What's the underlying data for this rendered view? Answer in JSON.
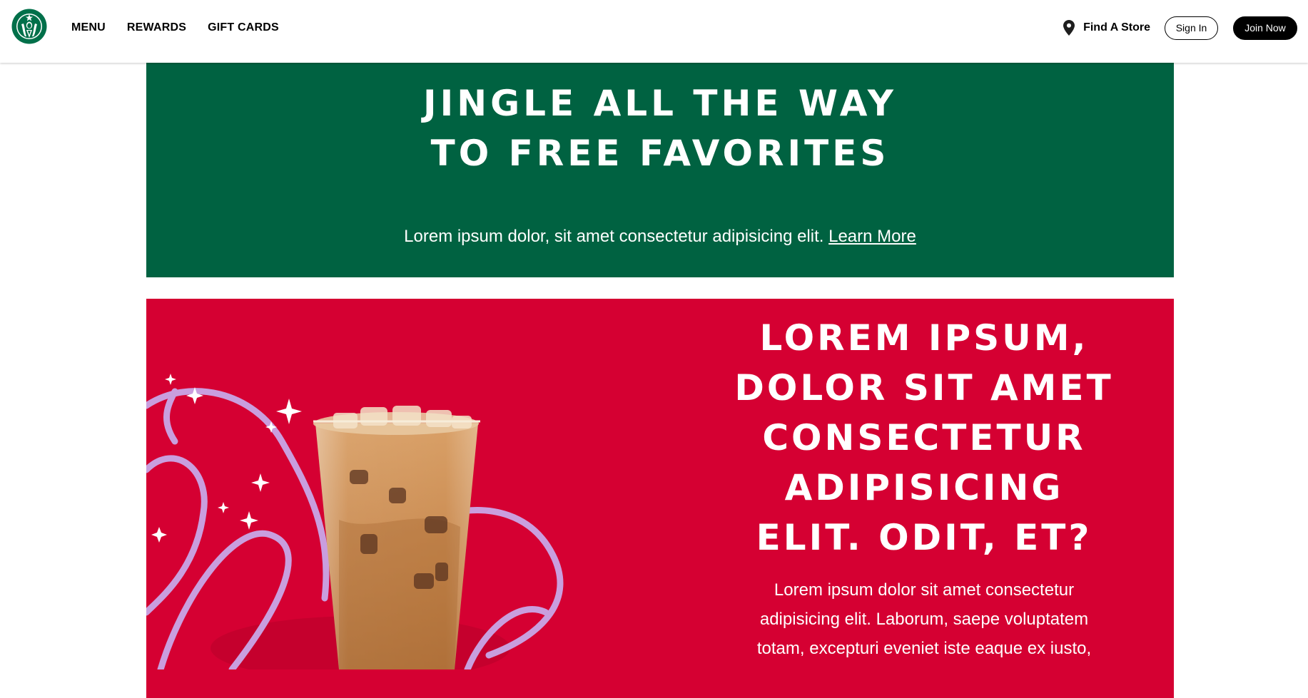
{
  "header": {
    "logo_icon": "starbucks-siren-logo",
    "nav": [
      {
        "label": "MENU"
      },
      {
        "label": "REWARDS"
      },
      {
        "label": "GIFT CARDS"
      }
    ],
    "find_store": {
      "icon": "map-pin-icon",
      "label": "Find A Store"
    },
    "sign_in_label": "Sign In",
    "join_now_label": "Join Now"
  },
  "green_banner": {
    "title": "JINGLE ALL THE WAY TO FREE FAVORITES",
    "text": "Lorem ipsum dolor, sit amet consectetur adipisicing elit.",
    "link_label": "Learn More",
    "background": "#006241"
  },
  "red_promo": {
    "title": "LOREM IPSUM, DOLOR SIT AMET CONSECTETUR ADIPISICING ELIT. ODIT, ET?",
    "text": "Lorem ipsum dolor sit amet consectetur adipisicing elit. Laborum, saepe voluptatem totam, excepturi eveniet iste eaque ex iusto,",
    "image": "iced-coffee-drink-with-ribbon-and-sparkles",
    "background": "#d50032"
  },
  "colors": {
    "brand_green": "#006241",
    "promo_red": "#d50032",
    "ribbon_lavender": "#c9a7e8"
  }
}
